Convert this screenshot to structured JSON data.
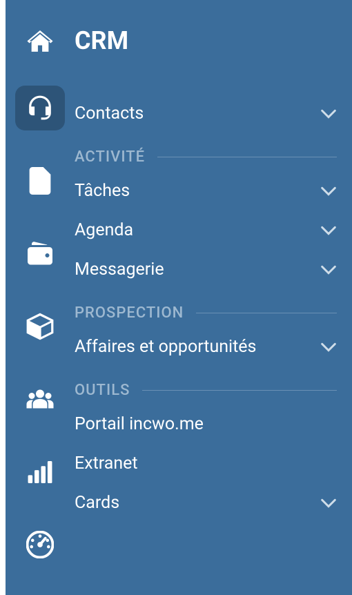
{
  "title": "CRM",
  "iconColumn": {
    "items": [
      {
        "name": "home-icon"
      },
      {
        "name": "headset-icon",
        "active": true
      },
      {
        "name": "document-icon"
      },
      {
        "name": "wallet-icon"
      },
      {
        "name": "box-icon"
      },
      {
        "name": "users-icon"
      },
      {
        "name": "chart-icon"
      },
      {
        "name": "dashboard-icon"
      }
    ]
  },
  "sections": {
    "top": {
      "items": [
        {
          "label": "Contacts",
          "expandable": true
        }
      ]
    },
    "activite": {
      "header": "ACTIVITÉ",
      "items": [
        {
          "label": "Tâches",
          "expandable": true
        },
        {
          "label": "Agenda",
          "expandable": true
        },
        {
          "label": "Messagerie",
          "expandable": true
        }
      ]
    },
    "prospection": {
      "header": "PROSPECTION",
      "items": [
        {
          "label": "Affaires et opportunités",
          "expandable": true
        }
      ]
    },
    "outils": {
      "header": "OUTILS",
      "items": [
        {
          "label": "Portail incwo.me",
          "expandable": false
        },
        {
          "label": "Extranet",
          "expandable": false
        },
        {
          "label": "Cards",
          "expandable": true
        }
      ]
    }
  }
}
